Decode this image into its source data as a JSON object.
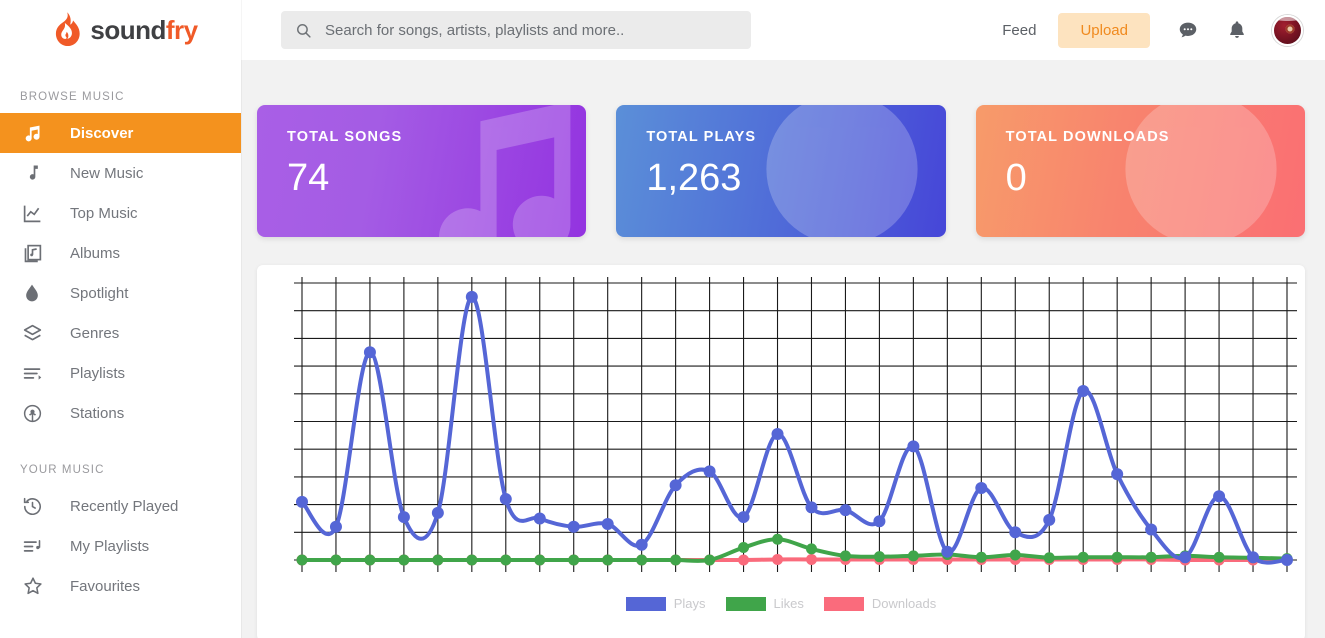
{
  "brand": {
    "name_part1": "sound",
    "name_part2": "fry",
    "logo_icon": "flame-icon"
  },
  "sidebar": {
    "browse_label": "BROWSE MUSIC",
    "your_music_label": "YOUR MUSIC",
    "browse_items": [
      {
        "label": "Discover",
        "icon": "music-notes-icon",
        "active": true
      },
      {
        "label": "New Music",
        "icon": "music-note-icon",
        "active": false
      },
      {
        "label": "Top Music",
        "icon": "line-chart-icon",
        "active": false
      },
      {
        "label": "Albums",
        "icon": "album-icon",
        "active": false
      },
      {
        "label": "Spotlight",
        "icon": "droplet-icon",
        "active": false
      },
      {
        "label": "Genres",
        "icon": "layers-icon",
        "active": false
      },
      {
        "label": "Playlists",
        "icon": "playlist-lines-icon",
        "active": false
      },
      {
        "label": "Stations",
        "icon": "radio-tower-icon",
        "active": false
      }
    ],
    "your_music_items": [
      {
        "label": "Recently Played",
        "icon": "history-clock-icon"
      },
      {
        "label": "My Playlists",
        "icon": "playlist-music-icon"
      },
      {
        "label": "Favourites",
        "icon": "star-icon"
      }
    ]
  },
  "header": {
    "search": {
      "placeholder": "Search for songs, artists, playlists and more..",
      "value": "",
      "icon": "search-icon"
    },
    "feed_label": "Feed",
    "upload_label": "Upload",
    "messages_icon": "chat-bubble-icon",
    "notifications_icon": "bell-icon",
    "avatar_icon": "user-avatar"
  },
  "stats": [
    {
      "title": "TOTAL SONGS",
      "value": "74",
      "color": "#a45ce4",
      "art": "music-note-watermark"
    },
    {
      "title": "TOTAL PLAYS",
      "value": "1,263",
      "color": "#5274d8",
      "art": "play-button-watermark"
    },
    {
      "title": "TOTAL DOWNLOADS",
      "value": "0",
      "color": "#f8836e",
      "art": "download-arrow-watermark"
    }
  ],
  "chart_data": {
    "type": "line",
    "title": "",
    "xlabel": "",
    "ylabel": "",
    "ylim": [
      0,
      10
    ],
    "grid": true,
    "legend_position": "bottom",
    "x": [
      1,
      2,
      3,
      4,
      5,
      6,
      7,
      8,
      9,
      10,
      11,
      12,
      13,
      14,
      15,
      16,
      17,
      18,
      19,
      20,
      21,
      22,
      23,
      24,
      25,
      26,
      27,
      28,
      29,
      30
    ],
    "series": [
      {
        "name": "Plays",
        "color": "#5566d6",
        "values": [
          2.1,
          1.2,
          7.5,
          1.55,
          1.7,
          9.5,
          2.2,
          1.5,
          1.2,
          1.3,
          0.55,
          2.7,
          3.2,
          1.55,
          4.55,
          1.9,
          1.8,
          1.4,
          4.1,
          0.3,
          2.6,
          1.0,
          1.45,
          6.1,
          3.1,
          1.1,
          0.1,
          2.3,
          0.1,
          0.0
        ]
      },
      {
        "name": "Likes",
        "color": "#40a54a",
        "values": [
          0,
          0,
          0,
          0,
          0,
          0,
          0,
          0,
          0,
          0,
          0,
          0,
          0,
          0.45,
          0.75,
          0.4,
          0.15,
          0.12,
          0.15,
          0.2,
          0.1,
          0.18,
          0.08,
          0.1,
          0.1,
          0.1,
          0.15,
          0.1,
          0.08,
          0.05
        ]
      },
      {
        "name": "Downloads",
        "color": "#fa6b7c",
        "values": [
          0,
          0,
          0,
          0,
          0,
          0,
          0,
          0,
          0,
          0,
          0,
          0,
          0,
          0,
          0.02,
          0.02,
          0.02,
          0.02,
          0.02,
          0.02,
          0.02,
          0.02,
          0.02,
          0.02,
          0.02,
          0.02,
          0,
          0,
          0,
          0
        ]
      }
    ],
    "legend": [
      {
        "label": "Plays",
        "color": "#5566d6"
      },
      {
        "label": "Likes",
        "color": "#40a54a"
      },
      {
        "label": "Downloads",
        "color": "#fa6b7c"
      }
    ]
  }
}
